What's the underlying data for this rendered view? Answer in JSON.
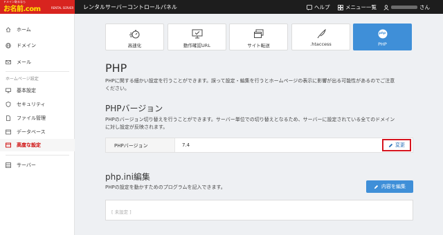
{
  "topbar": {
    "logo_sub": "ドメイン取るなら",
    "logo_main": "お名前.com",
    "logo_corp": "RENTAL SERVER",
    "title": "レンタルサーバーコントロールパネル",
    "help": "ヘルプ",
    "menu": "メニュー一覧",
    "user_suffix": "さん"
  },
  "sidebar": {
    "home": "ホーム",
    "domain": "ドメイン",
    "mail": "メール",
    "section_homepage": "ホームページ設定",
    "basic": "基本設定",
    "security": "セキュリティ",
    "files": "ファイル管理",
    "database": "データベース",
    "advanced": "高度な設定",
    "server": "サーバー"
  },
  "tabs": [
    "高速化",
    "動作確認URL",
    "サイト転送",
    ".htaccess",
    "PHP"
  ],
  "tab_php_badge": "php",
  "main": {
    "title": "PHP",
    "desc_line1": "PHPに関する細かい設定を行うことができます。誤って設定・編集を行うとホームページの表示に影響が出る可能性があるのでご注意",
    "desc_line2": "ください。",
    "version_title": "PHPバージョン",
    "version_desc_line1": "PHPのバージョン切り替えを行うことができます。サーバー単位での切り替えとなるため、サーバーに設定されている全てのドメイン",
    "version_desc_line2": "に対し設定が反映されます。",
    "version_label": "PHPバージョン",
    "version_value": "7.4",
    "change_button": "変更",
    "ini_title": "php.ini編集",
    "ini_desc": "PHPの設定を動かすためのプログラムを記入できます。",
    "ini_edit_button": "内容を編集",
    "ini_value": "[ 未設定 ]"
  },
  "colors": {
    "brand_red": "#d8241f",
    "accent_blue": "#3f8fd8",
    "highlight_red": "#d6141f"
  }
}
